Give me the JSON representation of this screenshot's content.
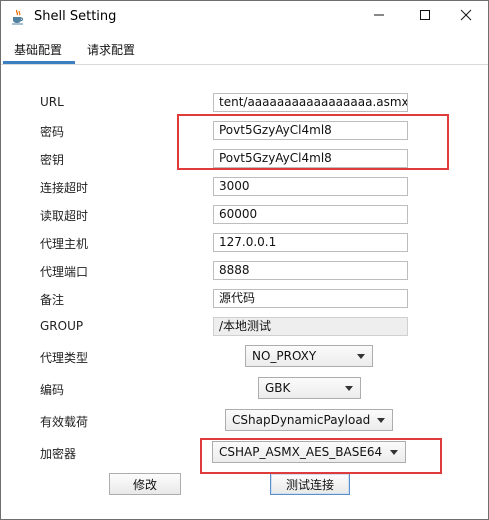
{
  "window": {
    "title": "Shell Setting",
    "icon": "java-cup-icon",
    "controls": [
      "minimize-icon",
      "maximize-icon",
      "close-icon"
    ]
  },
  "tabs": [
    {
      "label": "基础配置",
      "active": true
    },
    {
      "label": "请求配置",
      "active": false
    }
  ],
  "form": {
    "url": {
      "label": "URL",
      "value": "tent/aaaaaaaaaaaaaaaaa.asmx"
    },
    "password": {
      "label": "密码",
      "value": "Povt5GzyAyCl4ml8"
    },
    "secret_key": {
      "label": "密钥",
      "value": "Povt5GzyAyCl4ml8"
    },
    "connect_timeout": {
      "label": "连接超时",
      "value": "3000"
    },
    "read_timeout": {
      "label": "读取超时",
      "value": "60000"
    },
    "proxy_host": {
      "label": "代理主机",
      "value": "127.0.0.1"
    },
    "proxy_port": {
      "label": "代理端口",
      "value": "8888"
    },
    "remark": {
      "label": "备注",
      "value": "源代码"
    },
    "group": {
      "label": "GROUP",
      "value": "/本地测试"
    },
    "proxy_type": {
      "label": "代理类型",
      "selected": "NO_PROXY"
    },
    "encoding": {
      "label": "编码",
      "selected": "GBK"
    },
    "payload": {
      "label": "有效载荷",
      "selected": "CShapDynamicPayload"
    },
    "cryption": {
      "label": "加密器",
      "selected": "CSHAP_ASMX_AES_BASE64"
    }
  },
  "buttons": {
    "modify": "修改",
    "test_connection": "测试连接"
  },
  "colors": {
    "highlight": "#e03b3b",
    "tab_accent": "#3c7fc1"
  }
}
